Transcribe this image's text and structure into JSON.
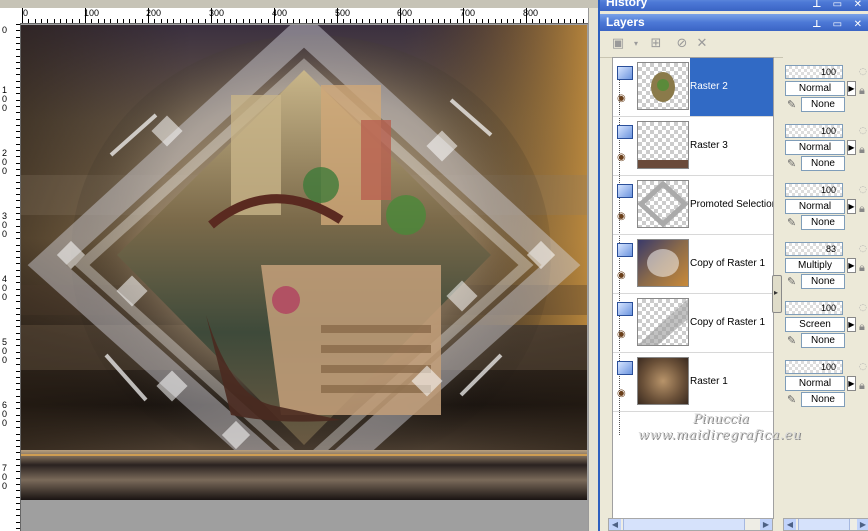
{
  "rulers": {
    "top_labels": [
      "0",
      "100",
      "200",
      "300",
      "400",
      "500",
      "600",
      "700",
      "800"
    ],
    "left_labels": [
      "0",
      "100",
      "200",
      "300",
      "400",
      "500",
      "600",
      "700"
    ]
  },
  "panels": {
    "history_title": "History",
    "layers_title": "Layers",
    "title_buttons": "⊥ ▭ ✕"
  },
  "layers": [
    {
      "name": "Raster 2",
      "opacity": "100",
      "blend": "Normal",
      "mask": "None",
      "selected": true
    },
    {
      "name": "Raster 3",
      "opacity": "100",
      "blend": "Normal",
      "mask": "None",
      "selected": false
    },
    {
      "name": "Promoted Selection",
      "opacity": "100",
      "blend": "Normal",
      "mask": "None",
      "selected": false
    },
    {
      "name": "Copy of Raster 1",
      "opacity": "83",
      "blend": "Multiply",
      "mask": "None",
      "selected": false
    },
    {
      "name": "Copy of Raster 1",
      "opacity": "100",
      "blend": "Screen",
      "mask": "None",
      "selected": false
    },
    {
      "name": "Raster 1",
      "opacity": "100",
      "blend": "Normal",
      "mask": "None",
      "selected": false
    }
  ],
  "watermark": {
    "line1": "Pinuccia",
    "line2": "www.maidiregrafica.eu"
  },
  "icons": {
    "layer": "layer-icon",
    "visibility": "eye-icon",
    "lock": "lock-icon",
    "mask": "mask-brush-icon"
  },
  "colors": {
    "title_bar": "#4c78d6",
    "selection": "#316ac5",
    "panel_bg": "#ece9d8"
  }
}
